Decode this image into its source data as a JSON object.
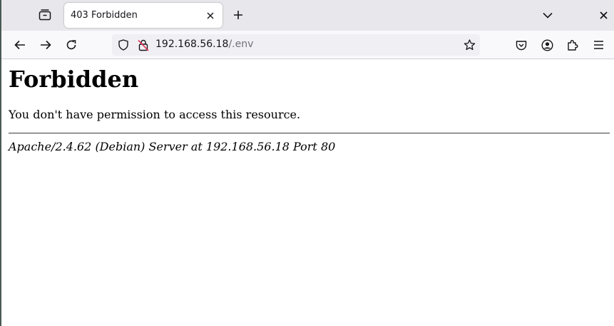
{
  "browser": {
    "tab": {
      "title": "403 Forbidden",
      "close_icon": "close-icon"
    },
    "tab_overview_icon": "tab-overview-icon",
    "new_tab_icon": "plus-icon",
    "list_tabs_icon": "chevron-down-icon",
    "window_close_icon": "close-icon",
    "nav": {
      "back_icon": "arrow-left-icon",
      "forward_icon": "arrow-right-icon",
      "reload_icon": "reload-icon"
    },
    "url": {
      "host": "192.168.56.18",
      "path": "/.env",
      "shield_icon": "tracking-protection-shield-icon",
      "lock_icon": "insecure-lock-icon",
      "bookmark_icon": "star-icon"
    },
    "toolbar_icons": [
      "pocket-icon",
      "account-icon",
      "extensions-icon",
      "hamburger-menu-icon"
    ]
  },
  "page": {
    "title": "Forbidden",
    "message": "You don't have permission to access this resource.",
    "footer": "Apache/2.4.62 (Debian) Server at 192.168.56.18 Port 80"
  },
  "colors": {
    "tabstrip_bg": "#e8e8ec",
    "navbar_bg": "#f9f9fb",
    "urlbar_bg": "#f0f0f4",
    "text": "#15141a",
    "url_path": "#6f6f77"
  }
}
